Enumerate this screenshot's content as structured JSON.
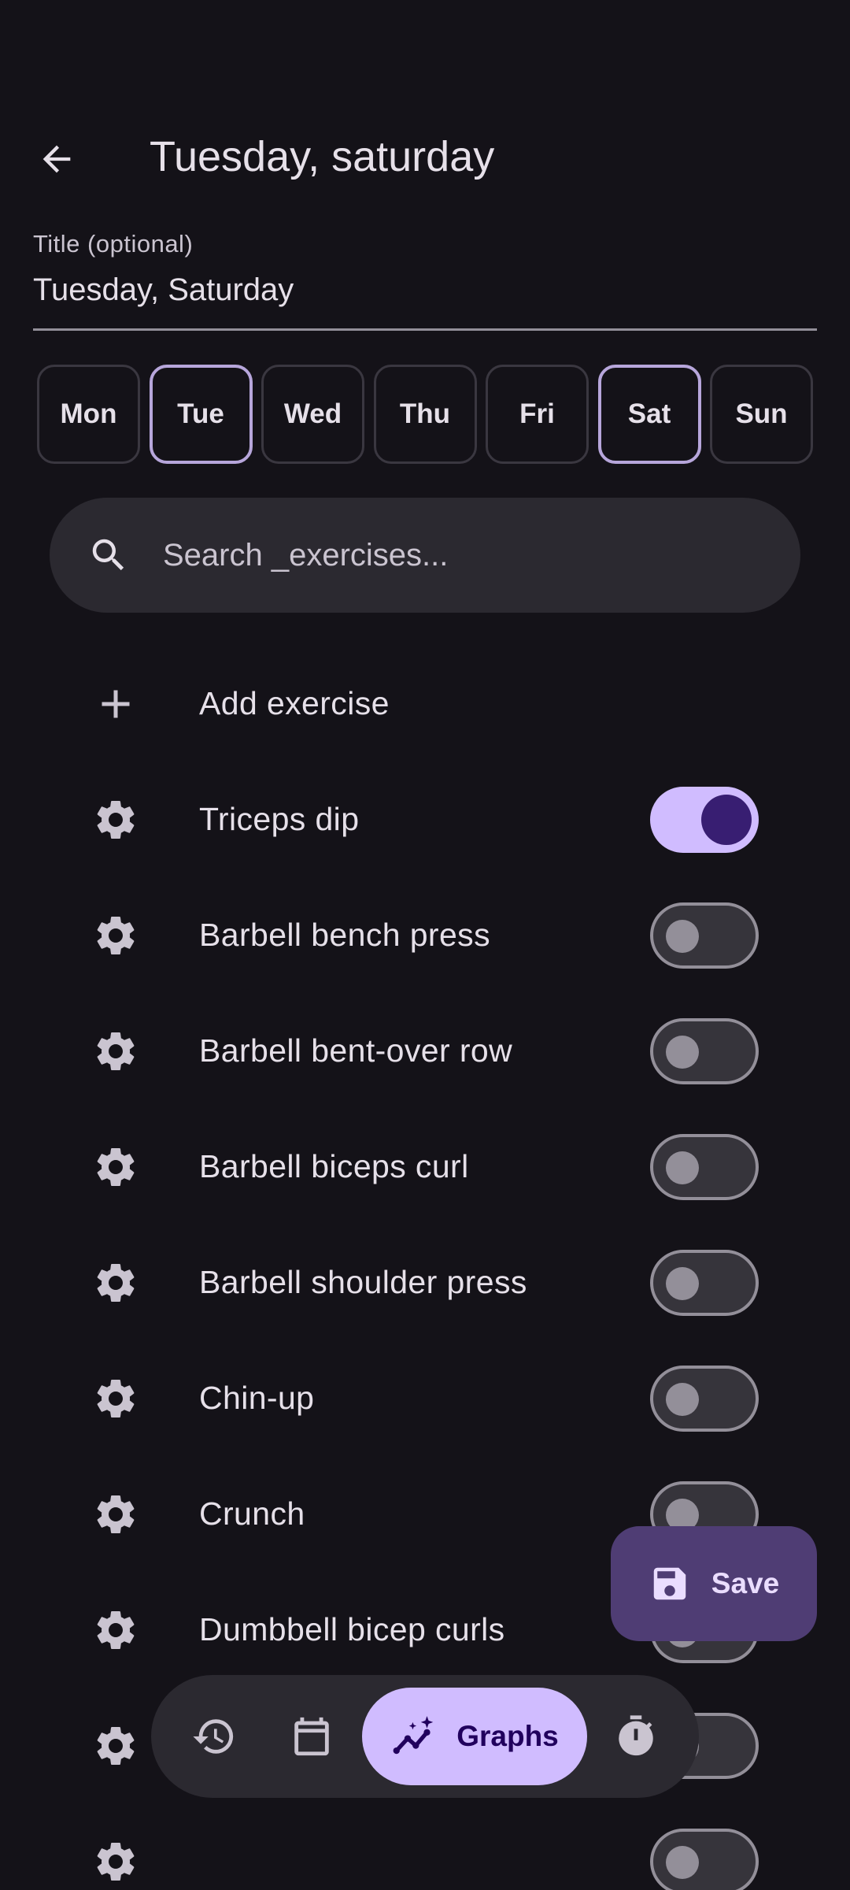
{
  "appbar": {
    "title": "Tuesday, saturday"
  },
  "title_field": {
    "label": "Title (optional)",
    "value": "Tuesday, Saturday"
  },
  "days": [
    {
      "label": "Mon",
      "selected": false
    },
    {
      "label": "Tue",
      "selected": true
    },
    {
      "label": "Wed",
      "selected": false
    },
    {
      "label": "Thu",
      "selected": false
    },
    {
      "label": "Fri",
      "selected": false
    },
    {
      "label": "Sat",
      "selected": true
    },
    {
      "label": "Sun",
      "selected": false
    }
  ],
  "search": {
    "placeholder": "Search _exercises..."
  },
  "add_exercise": {
    "label": "Add exercise"
  },
  "exercises": [
    {
      "name": "Triceps dip",
      "enabled": true
    },
    {
      "name": "Barbell bench press",
      "enabled": false
    },
    {
      "name": "Barbell bent-over row",
      "enabled": false
    },
    {
      "name": "Barbell biceps curl",
      "enabled": false
    },
    {
      "name": "Barbell shoulder press",
      "enabled": false
    },
    {
      "name": "Chin-up",
      "enabled": false
    },
    {
      "name": "Crunch",
      "enabled": false
    },
    {
      "name": "Dumbbell bicep curls",
      "enabled": false
    },
    {
      "name": "",
      "enabled": false
    },
    {
      "name": "",
      "enabled": false
    }
  ],
  "fab": {
    "label": "Save",
    "icon": "save-icon"
  },
  "nav": {
    "items": [
      {
        "icon": "history-icon"
      },
      {
        "icon": "calendar-icon"
      },
      {
        "icon": "graphs-icon",
        "label": "Graphs",
        "active": true
      },
      {
        "icon": "timer-icon"
      }
    ]
  },
  "colors": {
    "background": "#141218",
    "surface": "#2b2930",
    "primary": "#d0bcff",
    "on_primary": "#381e72",
    "fab": "#4f3d74",
    "chip_selected_border": "#b7a6db",
    "outline": "#938f99"
  }
}
